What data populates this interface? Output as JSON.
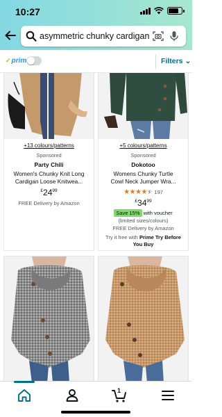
{
  "status_bar": {
    "time": "10:27",
    "battery_level": 0.8
  },
  "search": {
    "query": "asymmetric chunky cardigan"
  },
  "filter_bar": {
    "prime_label": "prime",
    "prime_toggle_on": false,
    "filters_label": "Filters"
  },
  "products": [
    {
      "colors_link": "+13 colours/patterns",
      "sponsored": "Sponsored",
      "brand": "Party Chili",
      "title_line1": "Women's Chunky Knit Long",
      "title_line2": "Cardigan Loose Knitwea...",
      "price_currency": "£",
      "price_whole": "24",
      "price_fraction": "99",
      "delivery": "FREE Delivery by Amazon"
    },
    {
      "colors_link": "+5 colours/patterns",
      "sponsored": "Sponsored",
      "brand": "Dokotoo",
      "title_line1": "Womens Chunky Turtle",
      "title_line2": "Cowl Neck Jumper Wra...",
      "rating": 4.5,
      "rating_count": "197",
      "price_currency": "£",
      "price_whole": "34",
      "price_fraction": "99",
      "save_badge": "Save 15%",
      "save_suffix": "with voucher",
      "limited": "(limited sizes/colours)",
      "delivery": "FREE Delivery by Amazon",
      "prime_try_prefix": "Try it free with",
      "prime_try_bold": "Prime Try Before You Buy"
    },
    {
      "image": "grey-cowl-neck-cardigan"
    },
    {
      "image": "camel-cowl-neck-cardigan"
    }
  ],
  "tab_bar": {
    "cart_count": "1",
    "active_tab": "home"
  },
  "colors": {
    "header_start": "#84d8e3",
    "header_end": "#a6e7ce",
    "link": "#007185",
    "star": "#de7921",
    "save_badge": "#7fda69"
  }
}
